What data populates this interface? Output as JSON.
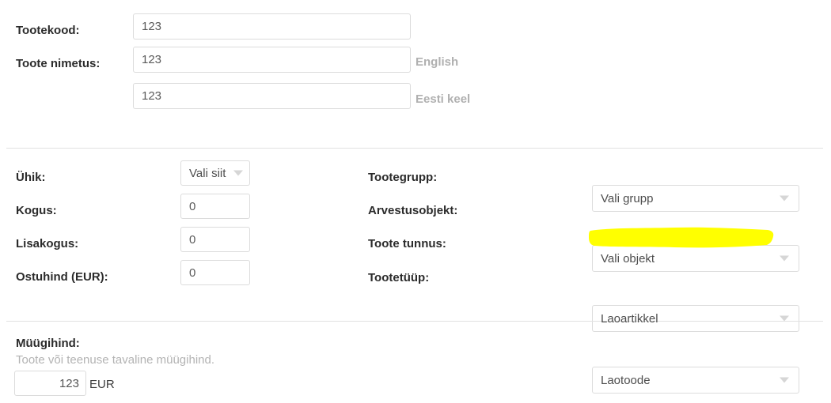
{
  "form": {
    "top_section": {
      "rows": [
        {
          "label": "Tootekood:",
          "value": "123"
        },
        {
          "label": "Toote nimetus:",
          "value": "123",
          "lang": "English"
        },
        {
          "label": "",
          "value": "123",
          "lang": "Eesti keel"
        }
      ]
    },
    "middle_section": {
      "left_fields": [
        {
          "label": "Ühik:",
          "value": "Vali siit",
          "control": "select"
        },
        {
          "label": "Kogus:",
          "value": "0",
          "control": "input"
        },
        {
          "label": "Lisakogus:",
          "value": "0",
          "control": "input"
        },
        {
          "label": "Ostuhind (EUR):",
          "value": "0",
          "control": "input"
        }
      ],
      "right_fields": [
        {
          "label": "Tootegrupp:",
          "value": "Vali grupp",
          "control": "select",
          "highlighted": false
        },
        {
          "label": "Arvestusobjekt:",
          "value": "Vali objekt",
          "control": "select",
          "highlighted": false
        },
        {
          "label": "Toote tunnus:",
          "value": "Laoartikkel",
          "control": "select",
          "highlighted": true
        },
        {
          "label": "Tootetüüp:",
          "value": "Laotoode",
          "control": "select",
          "highlighted": false
        }
      ]
    },
    "bottom_section": {
      "label": "Müügihind:",
      "help": "Toote või teenuse tavaline müügihind.",
      "value": "123",
      "currency": "EUR"
    }
  },
  "icons": {
    "caret": "chevron-down-icon"
  },
  "colors": {
    "highlight": "#ffff00",
    "border": "#dcdcdc",
    "divider": "#e2e2e2",
    "label": "#2b2b2b",
    "muted": "#b3b3b3"
  }
}
